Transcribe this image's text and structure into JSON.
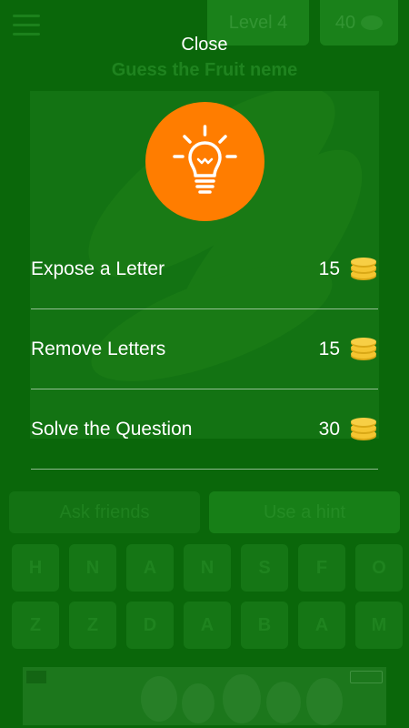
{
  "game": {
    "level_label": "Level 4",
    "coins": "40",
    "question_title": "Guess the Fruit neme",
    "ask_friends_label": "Ask friends",
    "use_hint_label": "Use a hint",
    "keyboard_row1": [
      "H",
      "N",
      "A",
      "N",
      "S",
      "F",
      "O"
    ],
    "keyboard_row2": [
      "Z",
      "Z",
      "D",
      "A",
      "B",
      "A",
      "M"
    ]
  },
  "hint_menu": {
    "close_label": "Close",
    "icon": "lightbulb-icon",
    "items": [
      {
        "label": "Expose a Letter",
        "cost": "15"
      },
      {
        "label": "Remove Letters",
        "cost": "15"
      },
      {
        "label": "Solve the Question",
        "cost": "30"
      }
    ]
  },
  "colors": {
    "background": "#0f7d10",
    "accent_orange": "#ff7d00",
    "coin_gold": "#f5c531"
  }
}
